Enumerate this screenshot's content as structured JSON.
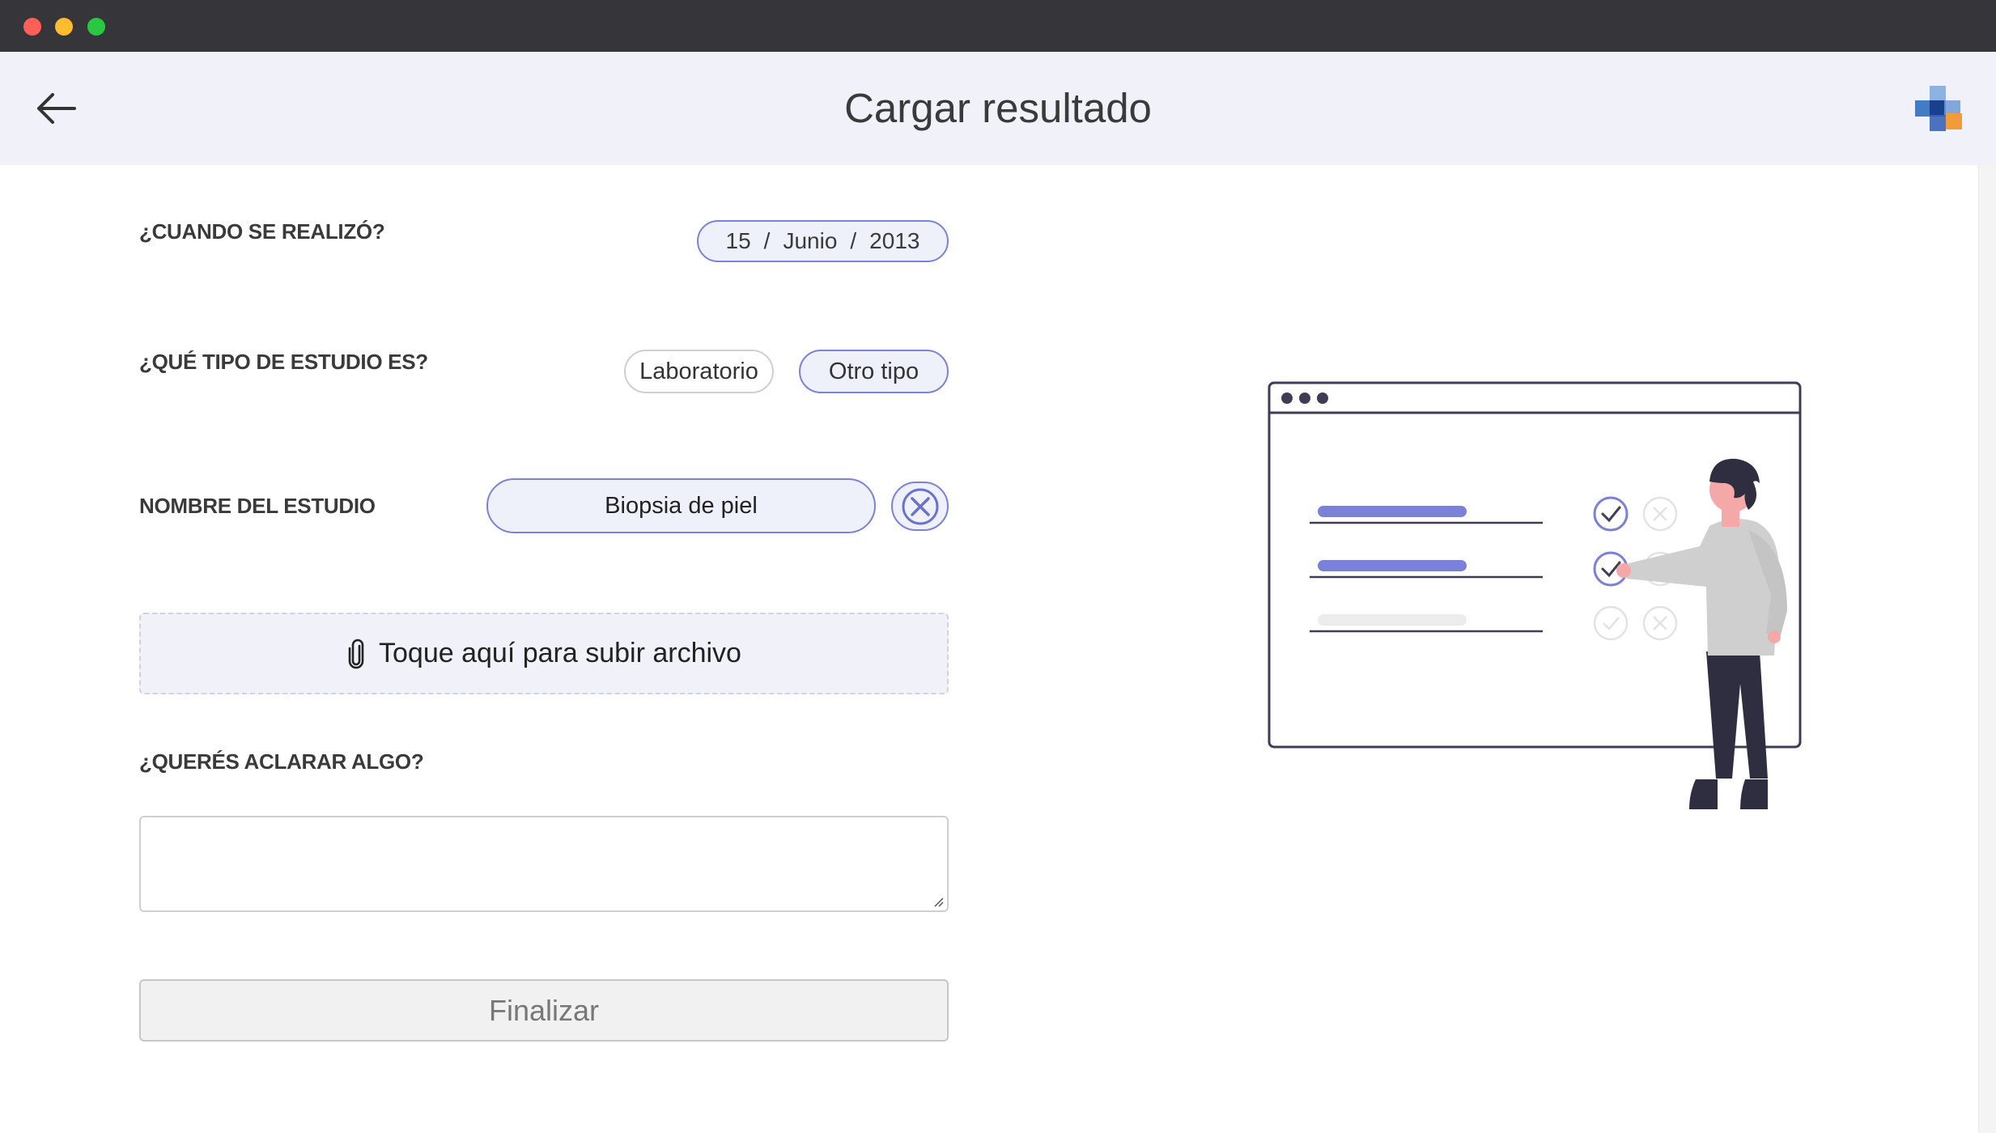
{
  "header": {
    "title": "Cargar resultado"
  },
  "form": {
    "date": {
      "label": "¿CUANDO SE REALIZÓ?",
      "day": "15",
      "month": "Junio",
      "year": "2013",
      "separator": "/"
    },
    "study_type": {
      "label": "¿QUÉ TIPO DE ESTUDIO ES?",
      "options": [
        "Laboratorio",
        "Otro tipo"
      ],
      "selected": "Otro tipo"
    },
    "study_name": {
      "label": "NOMBRE DEL ESTUDIO",
      "value": "Biopsia de piel"
    },
    "upload": {
      "label": "Toque aquí para subir archivo"
    },
    "comment": {
      "label": "¿QUERÉS ACLARAR ALGO?",
      "value": ""
    },
    "submit_label": "Finalizar"
  },
  "colors": {
    "accent": "#7b82d8",
    "accent_bg": "#eef0fa",
    "header_bg": "#f0f1f9",
    "titlebar": "#36363a"
  },
  "icons": {
    "back": "arrow-left-icon",
    "logo": "medical-cross-logo",
    "clear": "close-icon",
    "attach": "paperclip-icon"
  }
}
